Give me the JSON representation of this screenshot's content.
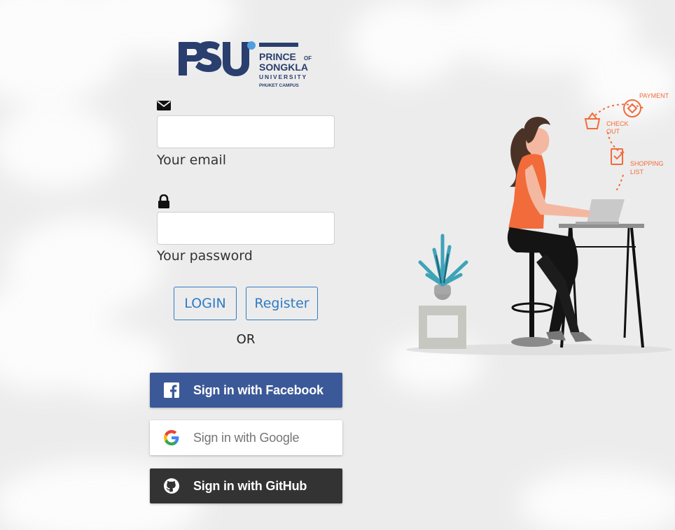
{
  "logo": {
    "mark": "PSU",
    "line1": "PRINCE",
    "line1_suffix": "OF",
    "line2": "SONGKLA",
    "line3": "UNIVERSITY",
    "line4": "PHUKET CAMPUS"
  },
  "login_form": {
    "email_label": "Your email",
    "email_value": "",
    "password_label": "Your password",
    "password_value": "",
    "login_button": "LOGIN",
    "register_button": "Register",
    "or_text": "OR"
  },
  "social": {
    "facebook_label": "Sign in with Facebook",
    "google_label": "Sign in with Google",
    "github_label": "Sign in with GitHub"
  },
  "illustration": {
    "payment": "PAYMENT",
    "check_out_1": "CHECK",
    "check_out_2": "OUT",
    "shopping_list_1": "SHOPPING",
    "shopping_list_2": "LIST"
  },
  "colors": {
    "primary": "#2e7bc4",
    "facebook": "#3b5998",
    "github": "#333333",
    "accent_orange": "#f26b3a",
    "logo_navy": "#2a3f6e"
  },
  "icons": {
    "email": "envelope-icon",
    "password": "lock-icon",
    "facebook": "facebook-icon",
    "google": "google-icon",
    "github": "github-icon"
  }
}
